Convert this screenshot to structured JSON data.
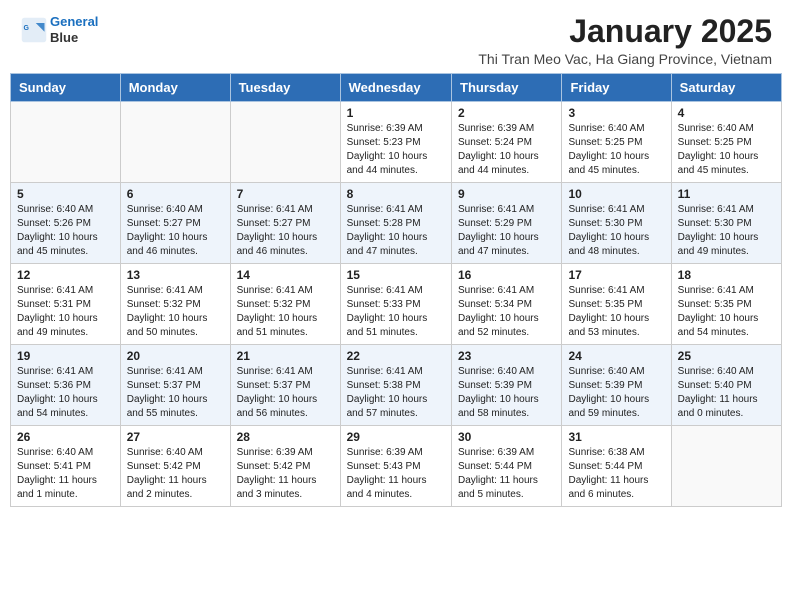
{
  "header": {
    "logo_line1": "General",
    "logo_line2": "Blue",
    "title": "January 2025",
    "subtitle": "Thi Tran Meo Vac, Ha Giang Province, Vietnam"
  },
  "days_of_week": [
    "Sunday",
    "Monday",
    "Tuesday",
    "Wednesday",
    "Thursday",
    "Friday",
    "Saturday"
  ],
  "weeks": [
    [
      {
        "day": "",
        "info": ""
      },
      {
        "day": "",
        "info": ""
      },
      {
        "day": "",
        "info": ""
      },
      {
        "day": "1",
        "info": "Sunrise: 6:39 AM\nSunset: 5:23 PM\nDaylight: 10 hours\nand 44 minutes."
      },
      {
        "day": "2",
        "info": "Sunrise: 6:39 AM\nSunset: 5:24 PM\nDaylight: 10 hours\nand 44 minutes."
      },
      {
        "day": "3",
        "info": "Sunrise: 6:40 AM\nSunset: 5:25 PM\nDaylight: 10 hours\nand 45 minutes."
      },
      {
        "day": "4",
        "info": "Sunrise: 6:40 AM\nSunset: 5:25 PM\nDaylight: 10 hours\nand 45 minutes."
      }
    ],
    [
      {
        "day": "5",
        "info": "Sunrise: 6:40 AM\nSunset: 5:26 PM\nDaylight: 10 hours\nand 45 minutes."
      },
      {
        "day": "6",
        "info": "Sunrise: 6:40 AM\nSunset: 5:27 PM\nDaylight: 10 hours\nand 46 minutes."
      },
      {
        "day": "7",
        "info": "Sunrise: 6:41 AM\nSunset: 5:27 PM\nDaylight: 10 hours\nand 46 minutes."
      },
      {
        "day": "8",
        "info": "Sunrise: 6:41 AM\nSunset: 5:28 PM\nDaylight: 10 hours\nand 47 minutes."
      },
      {
        "day": "9",
        "info": "Sunrise: 6:41 AM\nSunset: 5:29 PM\nDaylight: 10 hours\nand 47 minutes."
      },
      {
        "day": "10",
        "info": "Sunrise: 6:41 AM\nSunset: 5:30 PM\nDaylight: 10 hours\nand 48 minutes."
      },
      {
        "day": "11",
        "info": "Sunrise: 6:41 AM\nSunset: 5:30 PM\nDaylight: 10 hours\nand 49 minutes."
      }
    ],
    [
      {
        "day": "12",
        "info": "Sunrise: 6:41 AM\nSunset: 5:31 PM\nDaylight: 10 hours\nand 49 minutes."
      },
      {
        "day": "13",
        "info": "Sunrise: 6:41 AM\nSunset: 5:32 PM\nDaylight: 10 hours\nand 50 minutes."
      },
      {
        "day": "14",
        "info": "Sunrise: 6:41 AM\nSunset: 5:32 PM\nDaylight: 10 hours\nand 51 minutes."
      },
      {
        "day": "15",
        "info": "Sunrise: 6:41 AM\nSunset: 5:33 PM\nDaylight: 10 hours\nand 51 minutes."
      },
      {
        "day": "16",
        "info": "Sunrise: 6:41 AM\nSunset: 5:34 PM\nDaylight: 10 hours\nand 52 minutes."
      },
      {
        "day": "17",
        "info": "Sunrise: 6:41 AM\nSunset: 5:35 PM\nDaylight: 10 hours\nand 53 minutes."
      },
      {
        "day": "18",
        "info": "Sunrise: 6:41 AM\nSunset: 5:35 PM\nDaylight: 10 hours\nand 54 minutes."
      }
    ],
    [
      {
        "day": "19",
        "info": "Sunrise: 6:41 AM\nSunset: 5:36 PM\nDaylight: 10 hours\nand 54 minutes."
      },
      {
        "day": "20",
        "info": "Sunrise: 6:41 AM\nSunset: 5:37 PM\nDaylight: 10 hours\nand 55 minutes."
      },
      {
        "day": "21",
        "info": "Sunrise: 6:41 AM\nSunset: 5:37 PM\nDaylight: 10 hours\nand 56 minutes."
      },
      {
        "day": "22",
        "info": "Sunrise: 6:41 AM\nSunset: 5:38 PM\nDaylight: 10 hours\nand 57 minutes."
      },
      {
        "day": "23",
        "info": "Sunrise: 6:40 AM\nSunset: 5:39 PM\nDaylight: 10 hours\nand 58 minutes."
      },
      {
        "day": "24",
        "info": "Sunrise: 6:40 AM\nSunset: 5:39 PM\nDaylight: 10 hours\nand 59 minutes."
      },
      {
        "day": "25",
        "info": "Sunrise: 6:40 AM\nSunset: 5:40 PM\nDaylight: 11 hours\nand 0 minutes."
      }
    ],
    [
      {
        "day": "26",
        "info": "Sunrise: 6:40 AM\nSunset: 5:41 PM\nDaylight: 11 hours\nand 1 minute."
      },
      {
        "day": "27",
        "info": "Sunrise: 6:40 AM\nSunset: 5:42 PM\nDaylight: 11 hours\nand 2 minutes."
      },
      {
        "day": "28",
        "info": "Sunrise: 6:39 AM\nSunset: 5:42 PM\nDaylight: 11 hours\nand 3 minutes."
      },
      {
        "day": "29",
        "info": "Sunrise: 6:39 AM\nSunset: 5:43 PM\nDaylight: 11 hours\nand 4 minutes."
      },
      {
        "day": "30",
        "info": "Sunrise: 6:39 AM\nSunset: 5:44 PM\nDaylight: 11 hours\nand 5 minutes."
      },
      {
        "day": "31",
        "info": "Sunrise: 6:38 AM\nSunset: 5:44 PM\nDaylight: 11 hours\nand 6 minutes."
      },
      {
        "day": "",
        "info": ""
      }
    ]
  ]
}
